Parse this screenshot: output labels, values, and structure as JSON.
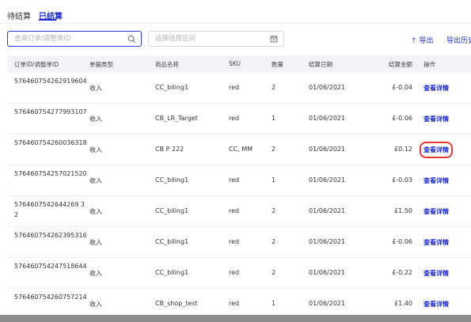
{
  "tabs": [
    {
      "label": "待结算",
      "active": false
    },
    {
      "label": "已结算",
      "active": true
    }
  ],
  "search": {
    "placeholder": "查询订单/调整单ID",
    "icon": "search-icon"
  },
  "date_range": {
    "placeholder": "选择结算区间",
    "icon": "calendar-icon"
  },
  "toolbar": {
    "export_label": "导出",
    "export_icon": "upload-icon",
    "history_label": "导出历史"
  },
  "table": {
    "headers": {
      "order_id": "订单ID/调整单ID",
      "doc_type": "单据类型",
      "product": "商品名称",
      "sku": "SKU",
      "qty": "数量",
      "date": "结算日期",
      "amount": "结算金额",
      "action": "操作"
    },
    "rows": [
      {
        "order_id": "576460754262919604",
        "doc_type": "收入",
        "product": "CC_biling1",
        "sku": "red",
        "qty": "2",
        "date": "01/06/2021",
        "amount": "£-0.04",
        "action": "查看详情"
      },
      {
        "order_id": "576460754277993107",
        "doc_type": "收入",
        "product": "CB_LR_Target",
        "sku": "red",
        "qty": "1",
        "date": "01/06/2021",
        "amount": "£-0.06",
        "action": "查看详情"
      },
      {
        "order_id": "576460754260036318",
        "doc_type": "收入",
        "product": "CB P 222",
        "sku": "CC, MM",
        "qty": "2",
        "date": "01/06/2021",
        "amount": "£0.12",
        "action": "查看详情"
      },
      {
        "order_id": "576460754257021520",
        "doc_type": "收入",
        "product": "CC_biling1",
        "sku": "red",
        "qty": "1",
        "date": "01/06/2021",
        "amount": "£-0.03",
        "action": "查看详情"
      },
      {
        "order_id": "5764607542644269 32",
        "doc_type": "收入",
        "product": "CC_biling1",
        "sku": "red",
        "qty": "2",
        "date": "01/06/2021",
        "amount": "£1.50",
        "action": "查看详情"
      },
      {
        "order_id": "576460754262395316",
        "doc_type": "收入",
        "product": "CC_biling1",
        "sku": "red",
        "qty": "2",
        "date": "01/06/2021",
        "amount": "£-0.06",
        "action": "查看详情"
      },
      {
        "order_id": "576460754247518644",
        "doc_type": "收入",
        "product": "CC_biling1",
        "sku": "red",
        "qty": "2",
        "date": "01/06/2021",
        "amount": "£-0.22",
        "action": "查看详情"
      },
      {
        "order_id": "576460754260757214",
        "doc_type": "收入",
        "product": "CB_shop_test",
        "sku": "red",
        "qty": "1",
        "date": "01/06/2021",
        "amount": "£1.40",
        "action": "查看详情"
      }
    ]
  },
  "colors": {
    "accent": "#1d2bcf",
    "highlight": "#e53935",
    "header_bg": "#f3f4f6"
  }
}
